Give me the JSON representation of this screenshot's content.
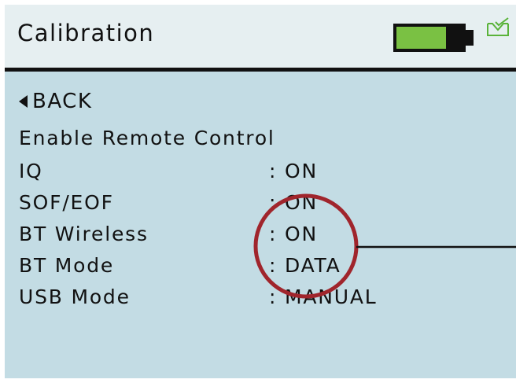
{
  "header": {
    "title": "Calibration",
    "battery": {
      "level": 0.75,
      "fill_color": "#7ac143"
    },
    "status_icon": "envelope-check-icon"
  },
  "back": {
    "label": "BACK",
    "icon": "left-triangle-icon"
  },
  "menu": {
    "title": "Enable Remote Control",
    "rows": [
      {
        "label": "IQ",
        "value": ": ON"
      },
      {
        "label": "SOF/EOF",
        "value": ": ON"
      },
      {
        "label": "BT Wireless",
        "value": ": ON"
      },
      {
        "label": "BT Mode",
        "value": ": DATA"
      },
      {
        "label": "USB Mode",
        "value": ": MANUAL"
      }
    ]
  },
  "annotation": {
    "shape": "circle-with-leader-line",
    "color": "#a0252c"
  },
  "colors": {
    "screen_background": "#c3dce4",
    "header_background": "#e6eff1",
    "text": "#111111",
    "icon_green": "#5ab33a"
  }
}
